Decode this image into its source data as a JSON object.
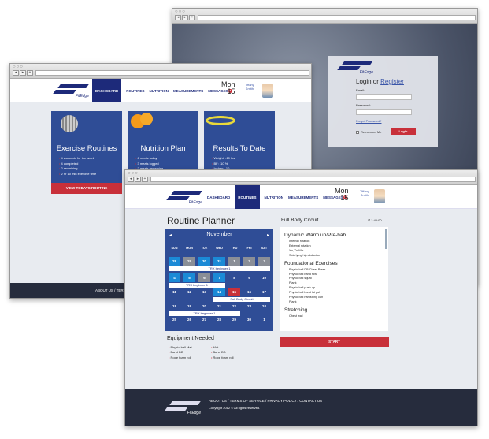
{
  "login_window": {
    "brand": "FitEdge",
    "heading": "Login or",
    "register_link": "Register",
    "email_label": "Email:",
    "password_label": "Password:",
    "forgot": "Forgot Password?",
    "remember": "Remember Me",
    "login_button": "Login"
  },
  "nav": {
    "items": [
      "DASHBOARD",
      "ROUTINES",
      "NUTRITION",
      "MEASUREMENTS",
      "MESSAGES"
    ],
    "messages_count": "6",
    "day": "Mon",
    "date": "15",
    "user_first": "Tiffany",
    "user_last": "Smith",
    "brand": "FitEdge"
  },
  "dashboard": {
    "cards": [
      {
        "title": "Exercise Routines",
        "items": [
          "4 workouts for the week",
          "4 completed",
          "2 remaining",
          "2 hr 10 min exercise time"
        ],
        "button": "VIEW TODAYS ROUTINE"
      },
      {
        "title": "Nutrition Plan",
        "items": [
          "6 meals today",
          "3 meals logged",
          "2 meals remaining"
        ]
      },
      {
        "title": "Results To Date",
        "items": [
          "Weight: -10 lbs",
          "BF: -10 %",
          "Inches: -10"
        ]
      }
    ]
  },
  "planner": {
    "title": "Routine Planner",
    "month": "November",
    "weekdays": [
      "SUN",
      "MON",
      "TUE",
      "WED",
      "THU",
      "FRI",
      "SAT"
    ],
    "weeks": [
      [
        "28",
        "29",
        "30",
        "31",
        "1",
        "2",
        "3"
      ],
      [
        "4",
        "5",
        "6",
        "7",
        "8",
        "9",
        "10"
      ],
      [
        "11",
        "12",
        "13",
        "14",
        "15",
        "16",
        "17"
      ],
      [
        "18",
        "19",
        "20",
        "21",
        "22",
        "23",
        "24"
      ],
      [
        "25",
        "26",
        "27",
        "28",
        "29",
        "30",
        "1"
      ]
    ],
    "events": [
      "TRX beginner 1",
      "TRX beginner 1",
      "Full Body Circuit",
      "TRX beginner 1"
    ],
    "equipment_title": "Equipment Needed",
    "equipment_left": [
      "Physio ball Mat",
      "Band DB",
      "Rope foam roll"
    ],
    "equipment_right": [
      "Mat",
      "Band DB",
      "Rope foam roll"
    ],
    "routine_name": "Full Body Circuit",
    "timer": "1:45:00",
    "sections": [
      {
        "title": "Dynamic Warm up/Pre-hab",
        "items": [
          "Internal rotation",
          "External rotation",
          "Y's,T's,W's",
          "Side lying hip abduction"
        ]
      },
      {
        "title": "Foundational Exercises",
        "items": [
          "Physio ball DB Chest Press",
          "Physio ball band row",
          "Physio ball squat",
          "Plank",
          "Physio ball push up",
          "Physio ball band lat pull",
          "Physio ball hamstring curl",
          "Plank"
        ]
      },
      {
        "title": "Stretching",
        "items": [
          "Chest wall"
        ]
      }
    ],
    "start": "START"
  },
  "footer": {
    "links": "ABOUT US / TERMS OF SERVICE / PRIVACY POLICY / CONTACT US",
    "copyright": "Copyright 2012 © All rights reserved.",
    "brand": "FitEdge"
  },
  "colors": {
    "navy": "#1d2a7a",
    "card_blue": "#2f4d96",
    "red": "#c8303a",
    "footer": "#262c3d"
  }
}
